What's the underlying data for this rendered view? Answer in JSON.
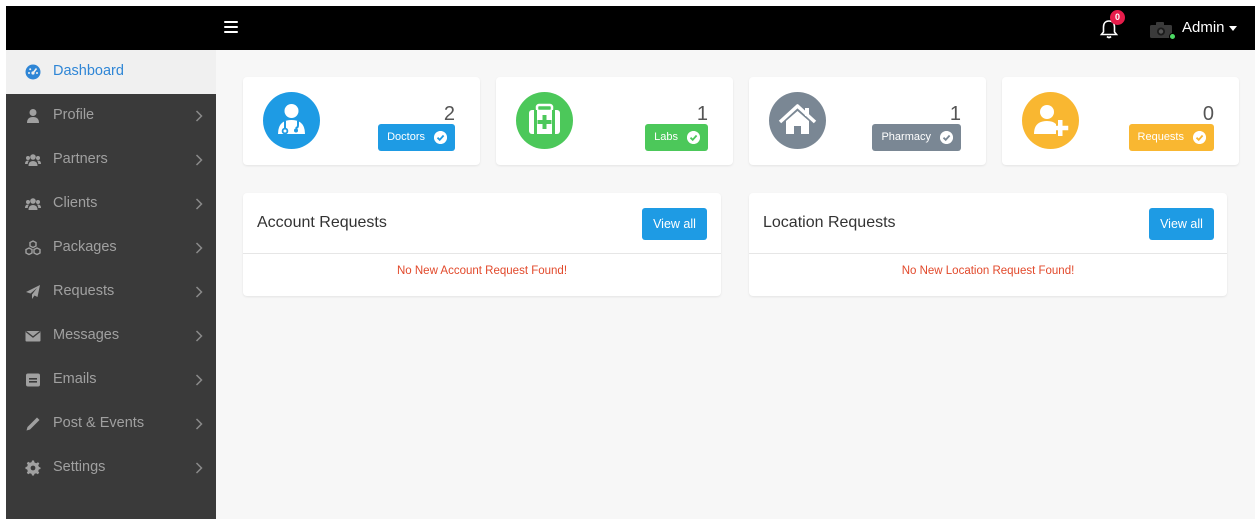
{
  "header": {
    "notification_count": "0",
    "user_name": "Admin"
  },
  "sidebar": {
    "items": [
      {
        "label": "Dashboard",
        "icon": "dashboard-icon",
        "active": true
      },
      {
        "label": "Profile",
        "icon": "user-icon"
      },
      {
        "label": "Partners",
        "icon": "users-icon"
      },
      {
        "label": "Clients",
        "icon": "users-icon"
      },
      {
        "label": "Packages",
        "icon": "cubes-icon"
      },
      {
        "label": "Requests",
        "icon": "paper-plane-icon"
      },
      {
        "label": "Messages",
        "icon": "envelope-icon"
      },
      {
        "label": "Emails",
        "icon": "email-box-icon"
      },
      {
        "label": "Post & Events",
        "icon": "pencil-icon"
      },
      {
        "label": "Settings",
        "icon": "gear-icon"
      }
    ]
  },
  "stats": [
    {
      "count": "2",
      "label": "Doctors",
      "color": "#1e9be4",
      "icon": "doctor-icon"
    },
    {
      "count": "1",
      "label": "Labs",
      "color": "#4cc85a",
      "icon": "medical-kit-icon"
    },
    {
      "count": "1",
      "label": "Pharmacy",
      "color": "#7a8794",
      "icon": "home-icon"
    },
    {
      "count": "0",
      "label": "Requests",
      "color": "#f9b731",
      "icon": "add-user-icon"
    }
  ],
  "panels": {
    "account": {
      "title": "Account Requests",
      "button": "View all",
      "empty": "No New Account Request Found!"
    },
    "location": {
      "title": "Location Requests",
      "button": "View all",
      "empty": "No New Location Request Found!"
    }
  },
  "colors": {
    "accent": "#1e9be4",
    "topbar": "#000000",
    "sidebar": "#3a3a3a",
    "error_text": "#e2492b"
  }
}
